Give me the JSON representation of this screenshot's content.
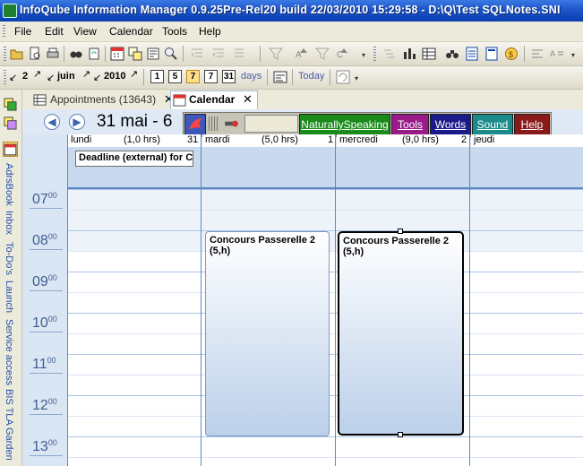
{
  "window": {
    "title": "InfoQube Information Manager 0.9.25Pre-Rel20  build 22/03/2010 15:29:58 - D:\\Q\\Test SQLNotes.SNI"
  },
  "menu": {
    "items": [
      "File",
      "Edit",
      "View",
      "Calendar",
      "Tools",
      "Help"
    ]
  },
  "datebar": {
    "day": "2",
    "month": "juin",
    "year": "2010",
    "day_buttons": [
      "1",
      "5",
      "7",
      "7",
      "31"
    ],
    "days_label": "days",
    "today_label": "Today"
  },
  "left_tabs": [
    "AdrsBook",
    "Inbox",
    "To-Do's",
    "Launch",
    "Service access",
    "BIS TLA",
    "Garden"
  ],
  "doc_tabs": [
    {
      "label": "Appointments (13643)",
      "active": false
    },
    {
      "label": "Calendar",
      "active": true
    }
  ],
  "calendar": {
    "range_label": "31 mai - 6",
    "days": [
      {
        "name": "lundi",
        "hours": "(1,0 hrs)",
        "date": "31"
      },
      {
        "name": "mardi",
        "hours": "(5,0 hrs)",
        "date": "1"
      },
      {
        "name": "mercredi",
        "hours": "(9,0 hrs)",
        "date": "2"
      },
      {
        "name": "jeudi",
        "hours": "",
        "date": ""
      }
    ],
    "allday_event": "Deadline (external) for C",
    "hours": [
      {
        "h": "07",
        "m": "00"
      },
      {
        "h": "08",
        "m": "00"
      },
      {
        "h": "09",
        "m": "00"
      },
      {
        "h": "10",
        "m": "00"
      },
      {
        "h": "11",
        "m": "00"
      },
      {
        "h": "12",
        "m": "00"
      },
      {
        "h": "13",
        "m": "00"
      }
    ],
    "events": [
      {
        "title": "Concours Passerelle 2",
        "detail": "(5,h)"
      },
      {
        "title": "Concours Passerelle 2",
        "detail": "(5,h)"
      }
    ]
  },
  "naturallyspeaking_bar": {
    "buttons": [
      {
        "label": "NaturallySpeaking",
        "color": "#1a8a1a"
      },
      {
        "label": "Tools",
        "color": "#9a1a8a"
      },
      {
        "label": "Words",
        "color": "#1a1a8a"
      },
      {
        "label": "Sound",
        "color": "#1a8a8a"
      },
      {
        "label": "Help",
        "color": "#8a1a1a"
      }
    ]
  }
}
